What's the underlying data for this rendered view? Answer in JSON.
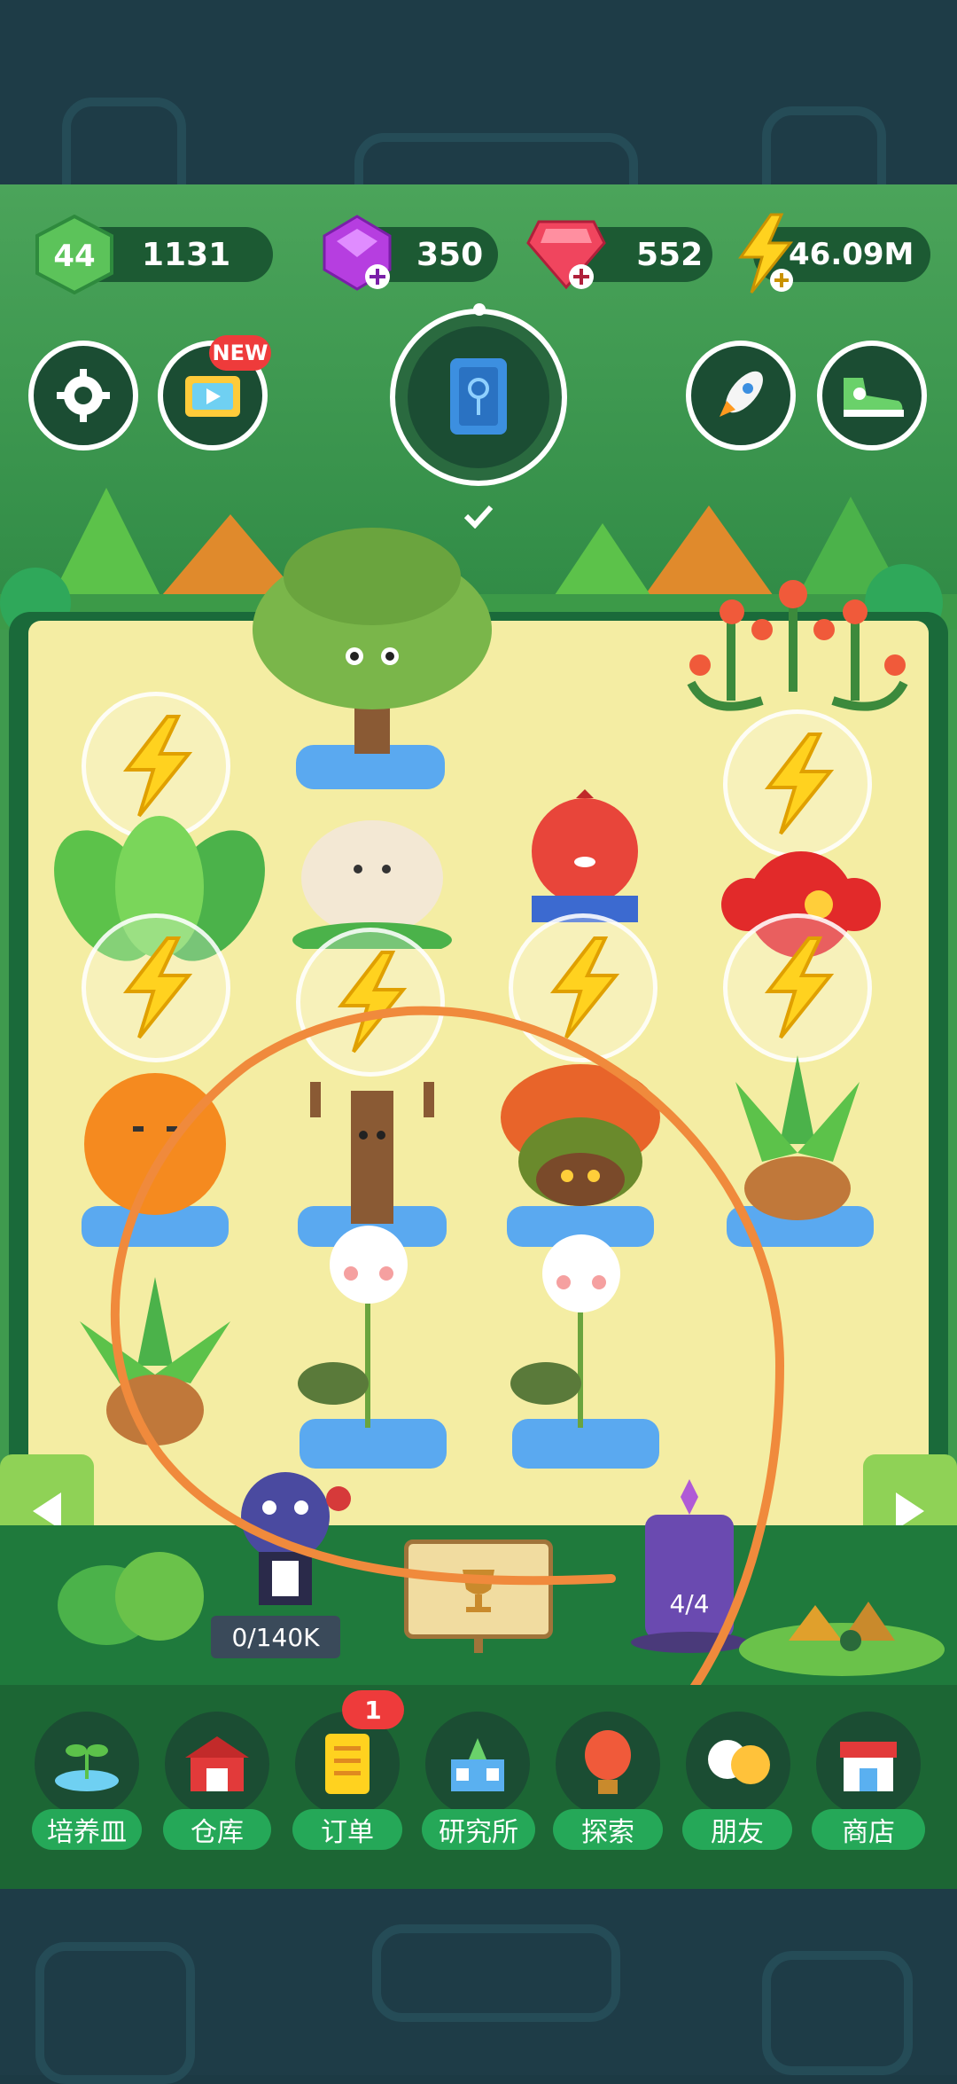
{
  "hud": {
    "level": "44",
    "coins": "1131",
    "gems_purple": "350",
    "gems_red": "552",
    "energy": "46.09M"
  },
  "buttons": {
    "video_badge": "NEW"
  },
  "garden": {
    "left_pedestal_value": "0/140K",
    "right_pedestal_value": "4/4"
  },
  "nav": {
    "order_badge": "1",
    "items": [
      {
        "label": "培养皿",
        "icon": "sprout-icon"
      },
      {
        "label": "仓库",
        "icon": "barn-icon"
      },
      {
        "label": "订单",
        "icon": "scroll-icon"
      },
      {
        "label": "研究所",
        "icon": "lab-icon"
      },
      {
        "label": "探索",
        "icon": "balloon-icon"
      },
      {
        "label": "朋友",
        "icon": "friends-icon"
      },
      {
        "label": "商店",
        "icon": "shop-icon"
      }
    ]
  },
  "colors": {
    "hud_pill": "#1c5a33",
    "nav_label": "#25a858",
    "garden_floor": "#f4eda3",
    "annotation_stroke": "#f08a3c"
  }
}
